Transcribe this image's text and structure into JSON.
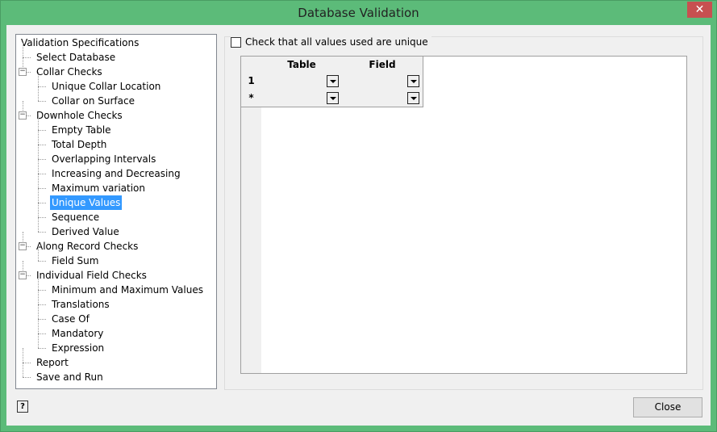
{
  "window": {
    "title": "Database Validation"
  },
  "tree": [
    {
      "label": "Validation Specifications",
      "level": 0
    },
    {
      "label": "Select Database",
      "level": 1
    },
    {
      "label": "Collar Checks",
      "level": 1,
      "expandable": true
    },
    {
      "label": "Unique Collar Location",
      "level": 2
    },
    {
      "label": "Collar on Surface",
      "level": 2
    },
    {
      "label": "Downhole Checks",
      "level": 1,
      "expandable": true
    },
    {
      "label": "Empty Table",
      "level": 2
    },
    {
      "label": "Total Depth",
      "level": 2
    },
    {
      "label": "Overlapping Intervals",
      "level": 2
    },
    {
      "label": "Increasing and Decreasing",
      "level": 2
    },
    {
      "label": "Maximum variation",
      "level": 2
    },
    {
      "label": "Unique Values",
      "level": 2,
      "selected": true
    },
    {
      "label": "Sequence",
      "level": 2
    },
    {
      "label": "Derived Value",
      "level": 2
    },
    {
      "label": "Along Record Checks",
      "level": 1,
      "expandable": true
    },
    {
      "label": "Field Sum",
      "level": 2
    },
    {
      "label": "Individual Field Checks",
      "level": 1,
      "expandable": true
    },
    {
      "label": "Minimum and Maximum Values",
      "level": 2
    },
    {
      "label": "Translations",
      "level": 2
    },
    {
      "label": "Case Of",
      "level": 2
    },
    {
      "label": "Mandatory",
      "level": 2
    },
    {
      "label": "Expression",
      "level": 2
    },
    {
      "label": "Report",
      "level": 1
    },
    {
      "label": "Save and Run",
      "level": 1
    }
  ],
  "unique_check": {
    "label": "Check that all values used are unique",
    "checked": false
  },
  "grid": {
    "columns": [
      "Table",
      "Field"
    ],
    "rows": [
      {
        "header": "1",
        "table": "",
        "field": ""
      },
      {
        "header": "*",
        "table": "",
        "field": ""
      }
    ]
  },
  "footer": {
    "close_label": "Close",
    "help_icon": "?"
  },
  "colors": {
    "titlebar": "#5cbb79",
    "selection": "#3399ff",
    "close_x": "#c75050"
  }
}
